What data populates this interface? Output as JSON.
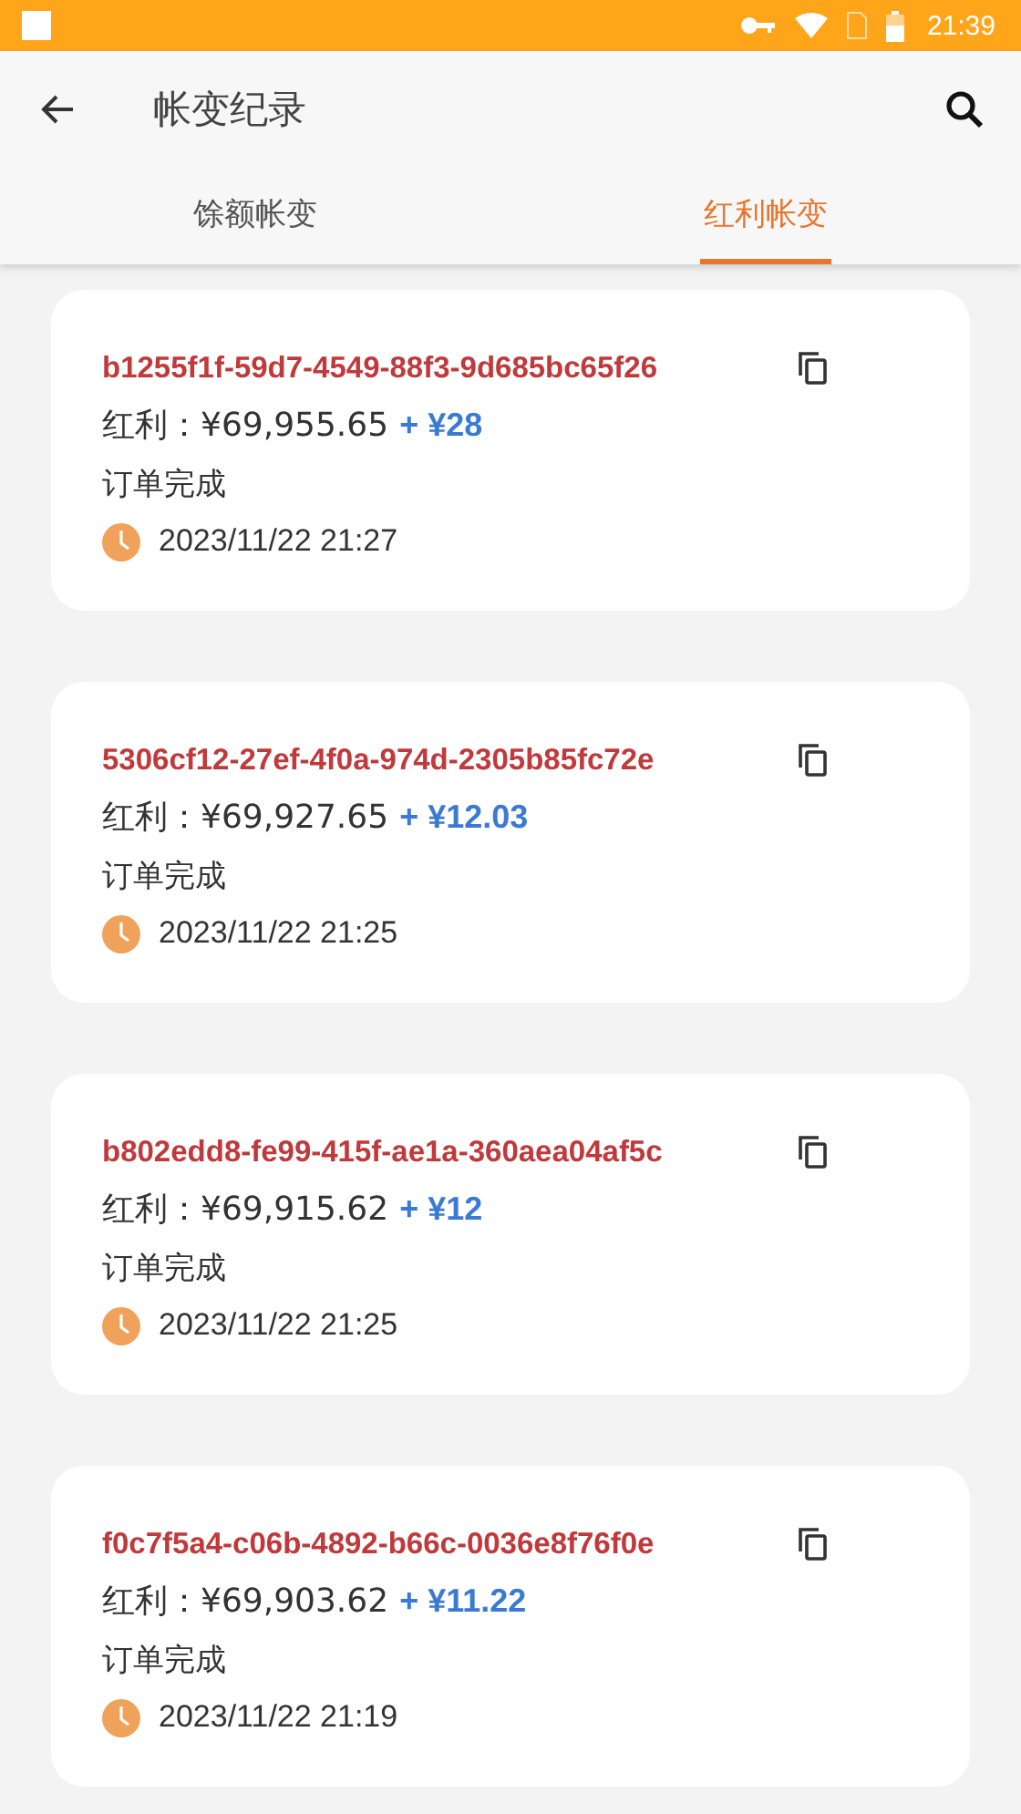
{
  "status_bar": {
    "time": "21:39"
  },
  "app_bar": {
    "title": "帐变纪录"
  },
  "tabs": [
    {
      "label": "馀额帐变",
      "selected": false
    },
    {
      "label": "红利帐变",
      "selected": true
    }
  ],
  "records": [
    {
      "id": "b1255f1f-59d7-4549-88f3-9d685bc65f26",
      "amount": "红利：¥69,955.65",
      "change": "+ ¥28",
      "status": "订单完成",
      "time": "2023/11/22 21:27"
    },
    {
      "id": "5306cf12-27ef-4f0a-974d-2305b85fc72e",
      "amount": "红利：¥69,927.65",
      "change": "+ ¥12.03",
      "status": "订单完成",
      "time": "2023/11/22 21:25"
    },
    {
      "id": "b802edd8-fe99-415f-ae1a-360aea04af5c",
      "amount": "红利：¥69,915.62",
      "change": "+ ¥12",
      "status": "订单完成",
      "time": "2023/11/22 21:25"
    },
    {
      "id": "f0c7f5a4-c06b-4892-b66c-0036e8f76f0e",
      "amount": "红利：¥69,903.62",
      "change": "+ ¥11.22",
      "status": "订单完成",
      "time": "2023/11/22 21:19"
    }
  ]
}
